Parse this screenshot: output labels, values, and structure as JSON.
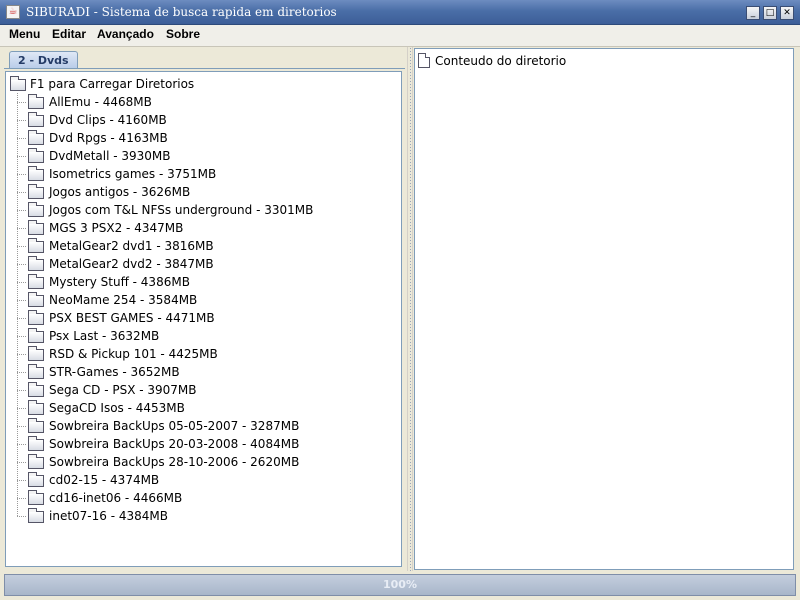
{
  "window": {
    "title": "SIBURADI - Sistema de busca rapida em diretorios",
    "icon": "java-icon",
    "controls": [
      "minimize",
      "maximize",
      "close"
    ]
  },
  "menu": [
    "Menu",
    "Editar",
    "Avançado",
    "Sobre"
  ],
  "left_panel": {
    "tab_label": "2 - Dvds",
    "tree_root": "F1 para Carregar Diretorios",
    "tree_items": [
      "AllEmu - 4468MB",
      "Dvd Clips - 4160MB",
      "Dvd Rpgs - 4163MB",
      "DvdMetall - 3930MB",
      "Isometrics games - 3751MB",
      "Jogos antigos - 3626MB",
      "Jogos com T&L NFSs underground - 3301MB",
      "MGS 3 PSX2  - 4347MB",
      "MetalGear2 dvd1 - 3816MB",
      "MetalGear2 dvd2 - 3847MB",
      "Mystery Stuff - 4386MB",
      "NeoMame 254  - 3584MB",
      "PSX BEST GAMES - 4471MB",
      "Psx Last - 3632MB",
      "RSD & Pickup 101 - 4425MB",
      "STR-Games - 3652MB",
      "Sega CD - PSX  - 3907MB",
      "SegaCD Isos - 4453MB",
      "Sowbreira BackUps 05-05-2007 -  3287MB",
      "Sowbreira BackUps 20-03-2008 - 4084MB",
      "Sowbreira BackUps 28-10-2006 - 2620MB",
      "cd02-15 - 4374MB",
      "cd16-inet06 - 4466MB",
      "inet07-16 - 4384MB"
    ]
  },
  "right_panel": {
    "title": "Conteudo do diretorio",
    "icon": "document-icon"
  },
  "status": {
    "progress_label": "100%",
    "progress_value": 1.0
  }
}
